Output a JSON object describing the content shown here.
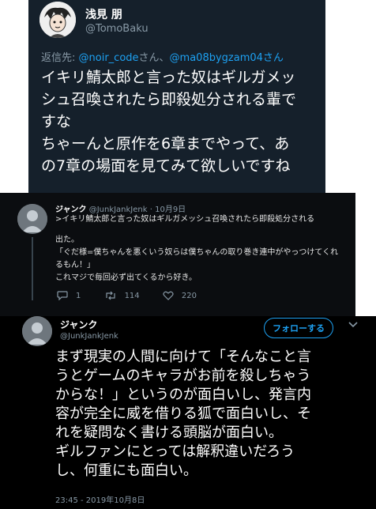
{
  "top_tweet": {
    "display_name": "浅見 朋",
    "handle": "@TomoBaku",
    "replying_prefix": "返信先: ",
    "mention_1": "@noir_code",
    "mention_sep": "さん、",
    "mention_2": "@ma08bygzam04",
    "mention_suffix": "さん",
    "body_lines": [
      "イキリ鯖太郎と言った奴はギルガメッ",
      "シュ召喚されたら即殺処分される輩で",
      "すな",
      "ちゃーんと原作を6章までやって、あ",
      "の7章の場面を見てみて欲しいですね"
    ]
  },
  "quoted_reply": {
    "display_name": "ジャンク",
    "handle": "@JunkJankJenk",
    "date": "10月9日",
    "separator": " · ",
    "lines": [
      ">イキリ鯖太郎と言った奴はギルガメッシュ召喚されたら即殺処分される",
      "出た。",
      "「ぐだ様=僕ちゃんを悪くいう奴らは僕ちゃんの取り巻き連中がやっつけてくれ",
      "るもん！」",
      "これマジで毎回必ず出てくるから好き。"
    ],
    "reply_count": "1",
    "retweet_count": "114",
    "like_count": "220"
  },
  "main_tweet": {
    "display_name": "ジャンク",
    "handle": "@JunkJankJenk",
    "follow_label": "フォローする",
    "body_lines": [
      "まず現実の人間に向けて「そんなこと言",
      "うとゲームのキャラがお前を殺しちゃう",
      "からな！」というのが面白いし、発言内",
      "容が完全に威を借りる狐で面白いし、そ",
      "れを疑問なく書ける頭脳が面白い。",
      "ギルファンにとっては解釈違いだろう",
      "し、何重にも面白い。"
    ],
    "timestamp": "23:45 - 2019年10月8日"
  },
  "colors": {
    "dim_bg": "#15202b",
    "dark_bg": "#0b0d10",
    "black_bg": "#000000",
    "accent": "#1da1f2",
    "muted": "#8899a6"
  }
}
